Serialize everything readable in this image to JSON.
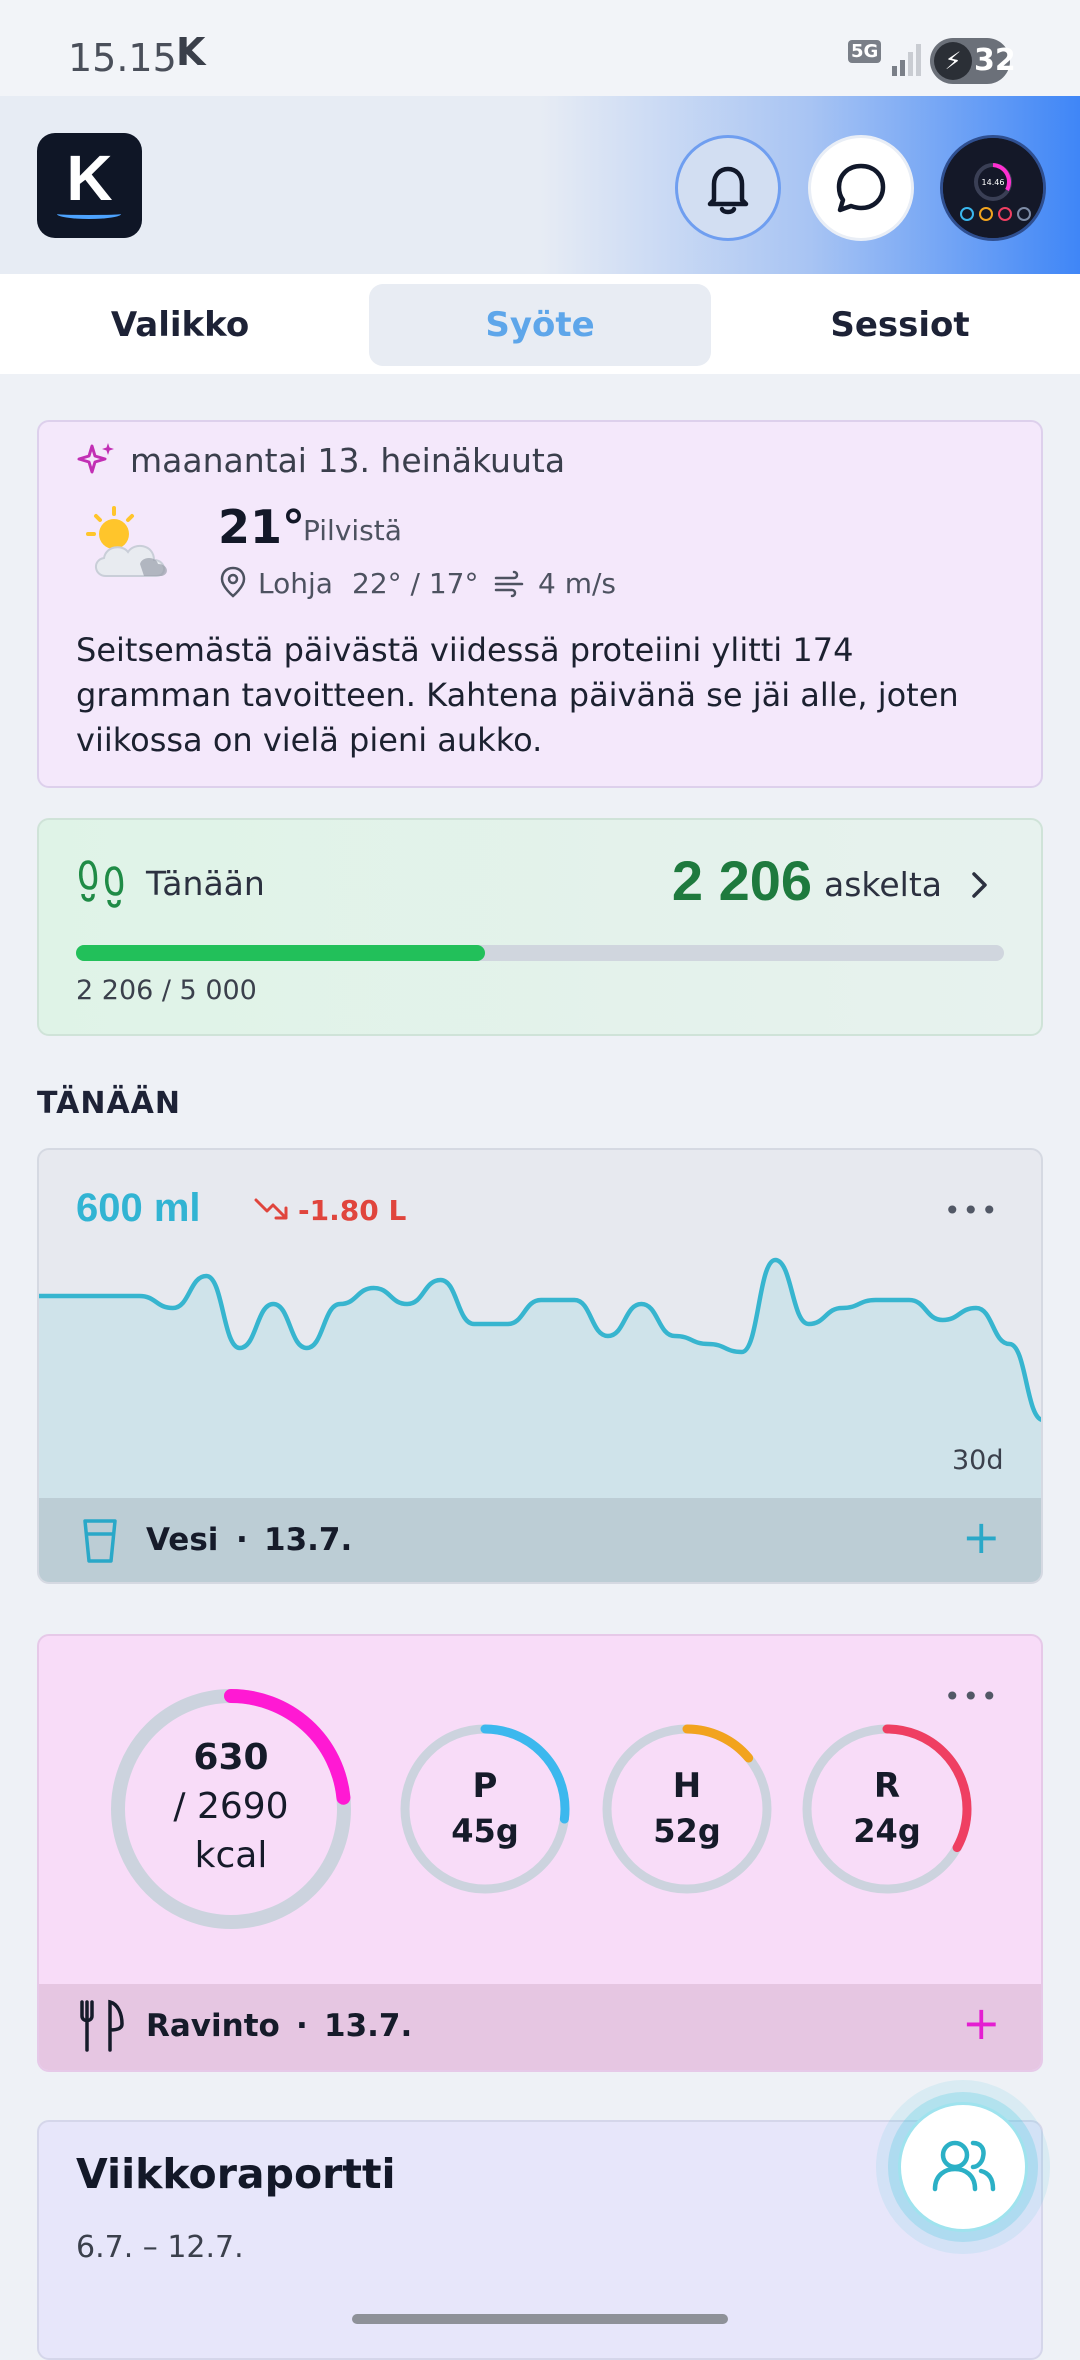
{
  "status_bar": {
    "time": "15.15",
    "app_letter": "K",
    "network": "5G",
    "battery": "32"
  },
  "header": {
    "logo_letter": "K",
    "avatar_time": "14.46"
  },
  "tabs": [
    {
      "label": "Valikko",
      "active": false
    },
    {
      "label": "Syöte",
      "active": true
    },
    {
      "label": "Sessiot",
      "active": false
    }
  ],
  "weather": {
    "date": "maanantai 13. heinäkuuta",
    "temperature": "21°",
    "condition": "Pilvistä",
    "location": "Lohja",
    "high_low": "22° / 17°",
    "wind": "4 m/s",
    "insight": [
      "Seitsemästä päivästä viidessä proteiini ylitti 174",
      "gramman tavoitteen. Kahtena päivänä se jäi alle, joten",
      "viikossa on vielä pieni aukko."
    ]
  },
  "steps": {
    "label": "Tänään",
    "count": "2 206",
    "unit": "askelta",
    "progress_text": "2 206 / 5 000",
    "progress": 0.441
  },
  "section_title": "TÄNÄÄN",
  "water": {
    "amount": "600 ml",
    "delta": "-1.80 L",
    "range_label": "30d",
    "footer_label": "Vesi",
    "footer_date": "13.7.",
    "more": "•••",
    "add": "+",
    "colors": {
      "line": "#37b5cf",
      "fill": "#cfe3ea",
      "delta": "#e0453d"
    }
  },
  "chart_data": {
    "type": "area",
    "range": "30d",
    "values": [
      62,
      62,
      62,
      62,
      56,
      72,
      36,
      58,
      36,
      58,
      66,
      58,
      70,
      48,
      48,
      60,
      60,
      42,
      58,
      42,
      38,
      34,
      80,
      48,
      56,
      60,
      60,
      50,
      56,
      38,
      0
    ],
    "ylim": [
      0,
      100
    ],
    "grid": false
  },
  "nutrition": {
    "calories_consumed": "630",
    "calories_goal": "/ 2690",
    "calories_unit": "kcal",
    "calories_fraction": 0.234,
    "macros": [
      {
        "letter": "P",
        "value": "45g",
        "color": "#3cb8ee",
        "fraction": 0.27
      },
      {
        "letter": "H",
        "value": "52g",
        "color": "#f2a31e",
        "fraction": 0.14
      },
      {
        "letter": "R",
        "value": "24g",
        "color": "#ef3f62",
        "fraction": 0.33
      }
    ],
    "ring_color": "#ff19d3",
    "footer_label": "Ravinto",
    "footer_date": "13.7.",
    "more": "•••",
    "add": "+"
  },
  "report": {
    "title": "Viikkoraportti",
    "range": "6.7. – 12.7."
  }
}
